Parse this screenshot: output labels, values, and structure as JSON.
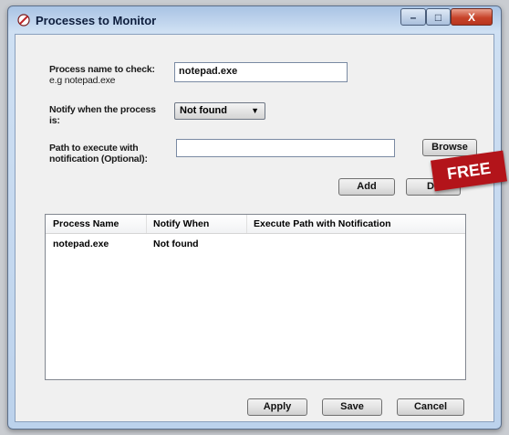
{
  "window": {
    "title": "Processes to Monitor",
    "controls": {
      "minimize": "–",
      "maximize": "□",
      "close": "X"
    }
  },
  "form": {
    "process_label_line1": "Process name to check:",
    "process_label_line2": "e.g notepad.exe",
    "process_value": "notepad.exe",
    "notify_label_line1": "Notify when the process",
    "notify_label_line2": "is:",
    "notify_selected": "Not found",
    "path_label_line1": "Path to execute with",
    "path_label_line2": "notification (Optional):",
    "path_value": "",
    "browse_label": "Browse",
    "add_label": "Add",
    "delete_label": "De"
  },
  "table": {
    "columns": [
      "Process Name",
      "Notify When",
      "Execute Path with Notification"
    ],
    "rows": [
      {
        "process": "notepad.exe",
        "notify": "Not found",
        "path": ""
      }
    ]
  },
  "footer": {
    "apply_label": "Apply",
    "save_label": "Save",
    "cancel_label": "Cancel"
  },
  "overlay": {
    "badge": "FREE"
  }
}
